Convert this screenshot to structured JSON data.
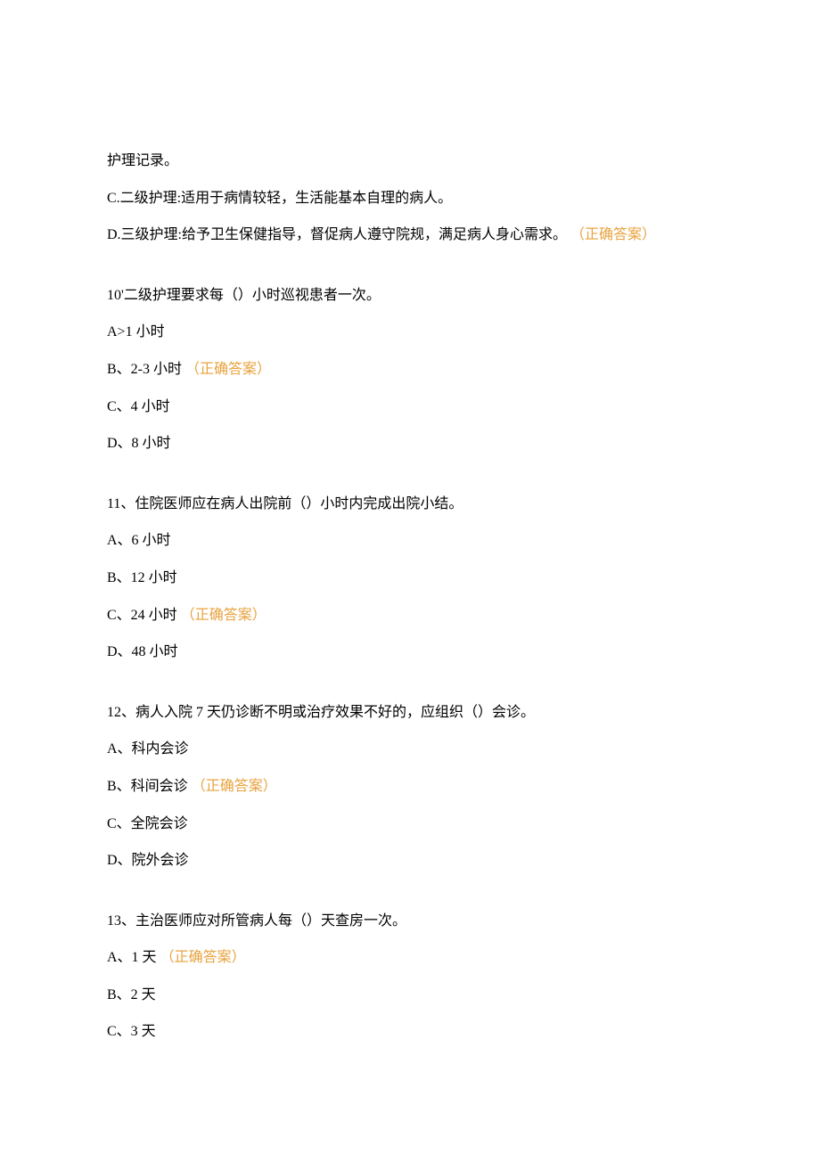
{
  "intro": {
    "line1": "护理记录。",
    "optC": "C.二级护理:适用于病情较轻，生活能基本自理的病人。",
    "optD_text": "D.三级护理:给予卫生保健指导，督促病人遵守院规，满足病人身心需求。",
    "optD_correct": "（正确答案）"
  },
  "q10": {
    "stem": "10'二级护理要求每（）小时巡视患者一次。",
    "a": "A>1 小时",
    "b_text": "B、2-3 小时",
    "b_correct": "（正确答案）",
    "c": "C、4 小时",
    "d": "D、8 小时"
  },
  "q11": {
    "stem": "11、住院医师应在病人出院前（）小时内完成出院小结。",
    "a": "A、6 小时",
    "b": "B、12 小时",
    "c_text": "C、24 小时",
    "c_correct": "（正确答案）",
    "d": "D、48 小时"
  },
  "q12": {
    "stem": "12、病人入院 7 天仍诊断不明或治疗效果不好的，应组织（）会诊。",
    "a": "A、科内会诊",
    "b_text": "B、科间会诊",
    "b_correct": "（正确答案）",
    "c": "C、全院会诊",
    "d": "D、院外会诊"
  },
  "q13": {
    "stem": "13、主治医师应对所管病人每（）天查房一次。",
    "a_text": "A、1 天",
    "a_correct": "（正确答案）",
    "b": "B、2 天",
    "c": "C、3 天"
  }
}
